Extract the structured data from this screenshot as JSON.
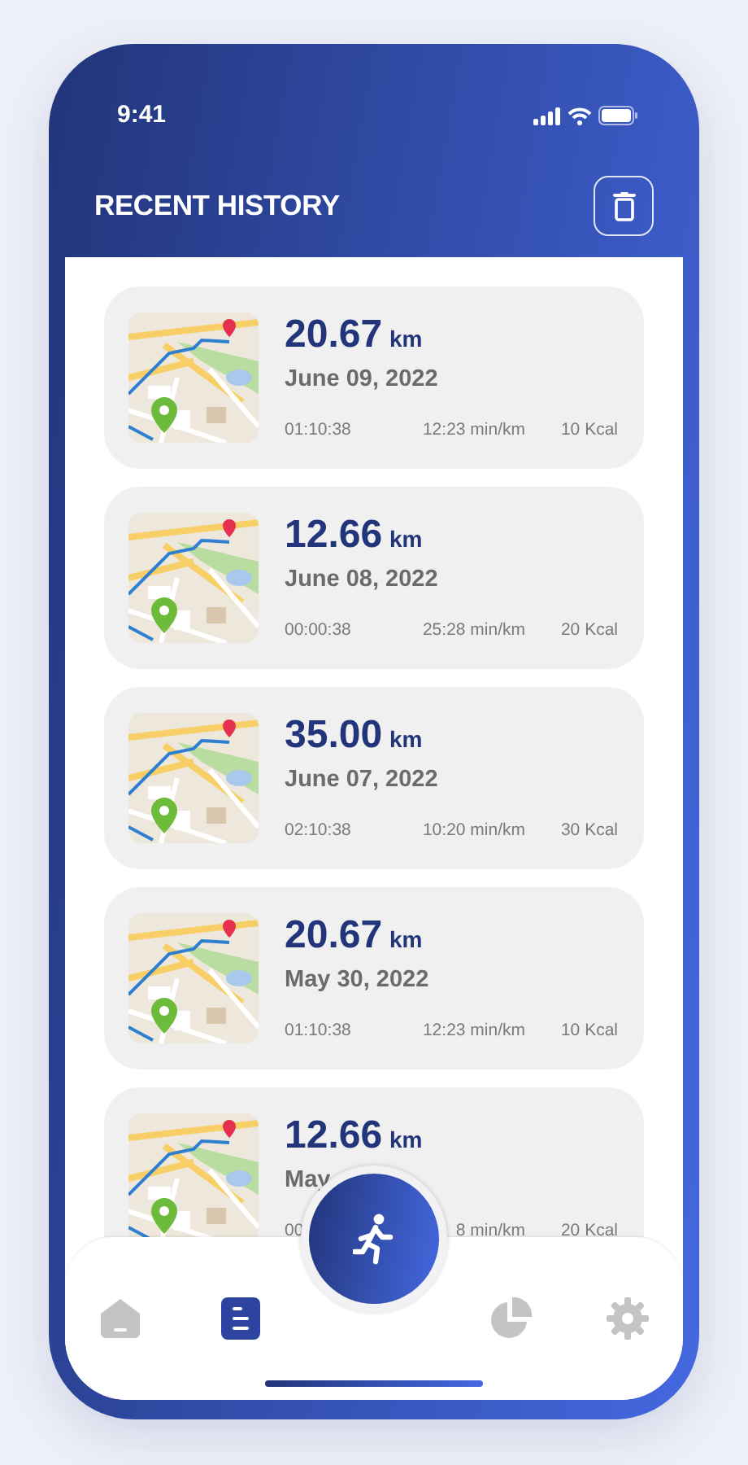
{
  "status_bar": {
    "time": "9:41"
  },
  "header": {
    "title": "RECENT HISTORY"
  },
  "runs": [
    {
      "distance": "20.67",
      "unit": "km",
      "date": "June 09, 2022",
      "duration": "01:10:38",
      "pace": "12:23 min/km",
      "calories": "10 Kcal"
    },
    {
      "distance": "12.66",
      "unit": "km",
      "date": "June 08, 2022",
      "duration": "00:00:38",
      "pace": "25:28 min/km",
      "calories": "20 Kcal"
    },
    {
      "distance": "35.00",
      "unit": "km",
      "date": "June 07, 2022",
      "duration": "02:10:38",
      "pace": "10:20 min/km",
      "calories": "30 Kcal"
    },
    {
      "distance": "20.67",
      "unit": "km",
      "date": "May 30, 2022",
      "duration": "01:10:38",
      "pace": "12:23 min/km",
      "calories": "10 Kcal"
    },
    {
      "distance": "12.66",
      "unit": "km",
      "date": "May",
      "duration": "00",
      "pace": "8 min/km",
      "calories": "20 Kcal"
    }
  ],
  "nav": [
    {
      "kind": "home",
      "selected": false
    },
    {
      "kind": "history",
      "selected": true
    },
    {
      "kind": "stats",
      "selected": false
    },
    {
      "kind": "settings",
      "selected": false
    }
  ]
}
